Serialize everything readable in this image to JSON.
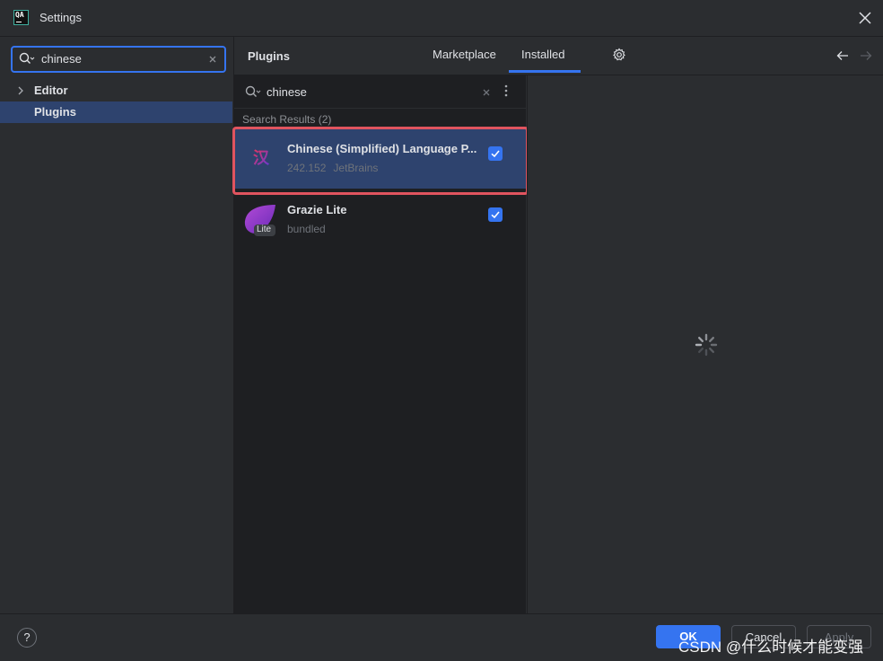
{
  "window": {
    "title": "Settings",
    "app_icon_text": "QA"
  },
  "sidebar": {
    "search_value": "chinese",
    "items": [
      {
        "label": "Editor",
        "expandable": true,
        "selected": false
      },
      {
        "label": "Plugins",
        "expandable": false,
        "selected": true
      }
    ]
  },
  "header": {
    "title": "Plugins",
    "tabs": [
      {
        "label": "Marketplace",
        "active": false
      },
      {
        "label": "Installed",
        "active": true
      }
    ]
  },
  "plugin_list": {
    "search_value": "chinese",
    "results_label": "Search Results (2)",
    "plugins": [
      {
        "name": "Chinese (Simplified) Language P...",
        "version": "242.152",
        "vendor": "JetBrains",
        "enabled": true,
        "selected": true,
        "icon": "han-character-icon"
      },
      {
        "name": "Grazie Lite",
        "version": "",
        "vendor": "bundled",
        "enabled": true,
        "selected": false,
        "icon": "grazie-lite-icon",
        "icon_badge": "Lite"
      }
    ]
  },
  "footer": {
    "help_label": "?",
    "ok_label": "OK",
    "cancel_label": "Cancel",
    "apply_label": "Apply"
  },
  "watermark": "CSDN @什么时候才能变强",
  "colors": {
    "accent": "#3574f0",
    "selection": "#2e436e",
    "highlight_border": "#e0545f",
    "panel_bg": "#2b2d30",
    "list_bg": "#1e1f22"
  }
}
